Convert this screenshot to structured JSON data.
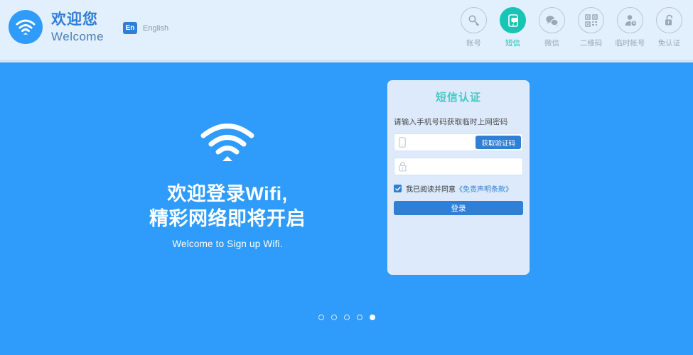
{
  "header": {
    "brand_cn": "欢迎您",
    "brand_en": "Welcome",
    "logo_icon": "wifi-icon",
    "language": {
      "badge": "En",
      "label": "English"
    },
    "nav": [
      {
        "label": "账号",
        "icon": "key-icon",
        "active": false
      },
      {
        "label": "短信",
        "icon": "sms-phone-icon",
        "active": true
      },
      {
        "label": "微信",
        "icon": "wechat-icon",
        "active": false
      },
      {
        "label": "二维码",
        "icon": "qrcode-icon",
        "active": false
      },
      {
        "label": "临时帐号",
        "icon": "temp-user-icon",
        "active": false
      },
      {
        "label": "免认证",
        "icon": "unlock-icon",
        "active": false
      }
    ]
  },
  "hero": {
    "icon": "wifi-signal-icon",
    "title_line1": "欢迎登录Wifi,",
    "title_line2": "精彩网络即将开启",
    "subtitle": "Welcome to Sign up Wifi."
  },
  "card": {
    "title": "短信认证",
    "hint": "请输入手机号码获取临时上网密码",
    "phone": {
      "icon": "mobile-phone-icon",
      "value": "",
      "placeholder": ""
    },
    "code_button": "获取验证码",
    "password": {
      "icon": "lock-icon",
      "value": "",
      "placeholder": ""
    },
    "agreement": {
      "checked": true,
      "text": "我已阅读并同意",
      "link": "《免责声明条款》"
    },
    "login_button": "登录"
  },
  "pagination": {
    "count": 5,
    "active_index": 4
  },
  "colors": {
    "page_blue": "#2f9bfa",
    "header_blue": "#e2effd",
    "accent_blue": "#2f7fd6",
    "active_teal": "#18c4b4",
    "title_teal": "#45c9c2",
    "card_bg": "#dceafb",
    "muted_gray": "#9aa8b5"
  }
}
